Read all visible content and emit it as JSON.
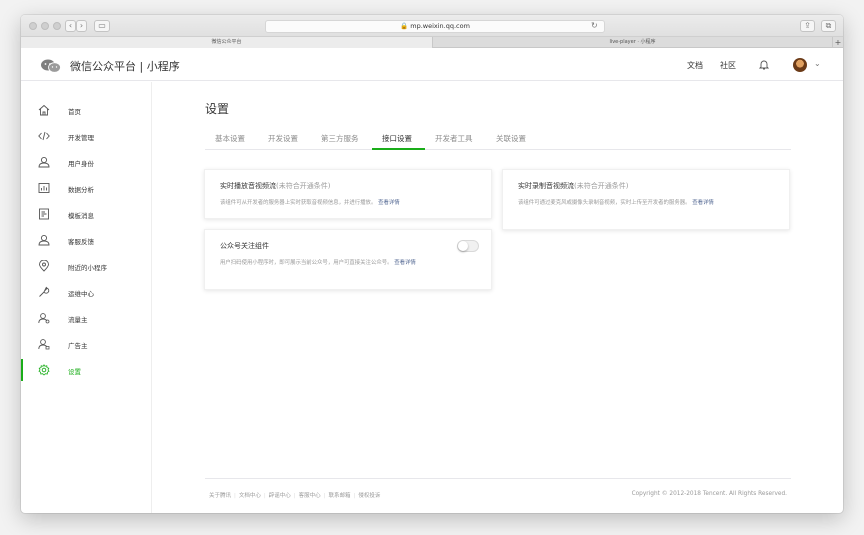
{
  "browser": {
    "url": "mp.weixin.qq.com",
    "tabs": [
      "微信公众平台",
      "live-player · 小程序"
    ]
  },
  "header": {
    "brand": "微信公众平台 | 小程序",
    "links": [
      "文档",
      "社区"
    ]
  },
  "sidebar": {
    "items": [
      {
        "label": "首页",
        "icon": "home-icon"
      },
      {
        "label": "开发管理",
        "icon": "code-icon"
      },
      {
        "label": "用户身份",
        "icon": "user-icon"
      },
      {
        "label": "数据分析",
        "icon": "chart-icon"
      },
      {
        "label": "模板消息",
        "icon": "template-icon"
      },
      {
        "label": "客服反馈",
        "icon": "support-icon"
      },
      {
        "label": "附近的小程序",
        "icon": "location-icon"
      },
      {
        "label": "运维中心",
        "icon": "wrench-icon"
      },
      {
        "label": "流量主",
        "icon": "traffic-icon"
      },
      {
        "label": "广告主",
        "icon": "advertiser-icon"
      },
      {
        "label": "设置",
        "icon": "gear-icon",
        "active": true
      }
    ]
  },
  "main": {
    "title": "设置",
    "tabs": [
      "基本设置",
      "开发设置",
      "第三方服务",
      "接口设置",
      "开发者工具",
      "关联设置"
    ],
    "active_tab": "接口设置",
    "cards": [
      {
        "title": "实时播放音视频流",
        "status": "(未符合开通条件)",
        "desc": "该组件可从开发者的服务器上实时获取音视频信息，并进行播放。",
        "link": "查看详情"
      },
      {
        "title": "实时录制音视频流",
        "status": "(未符合开通条件)",
        "desc": "该组件可通过麦克风或摄像头录制音视频，实时上传至开发者的服务器。",
        "link": "查看详情"
      },
      {
        "title": "公众号关注组件",
        "status": "",
        "desc": "用户扫码使用小程序时，即可展示当前公众号，用户可直接关注公众号。",
        "link": "查看详情",
        "toggle": false
      }
    ]
  },
  "footer": {
    "links": [
      "关于腾讯",
      "文档中心",
      "辟谣中心",
      "客服中心",
      "联系邮箱",
      "侵权投诉"
    ],
    "copyright": "Copyright © 2012-2018 Tencent. All Rights Reserved."
  },
  "colors": {
    "accent": "#1aad19",
    "link": "#576b95"
  }
}
